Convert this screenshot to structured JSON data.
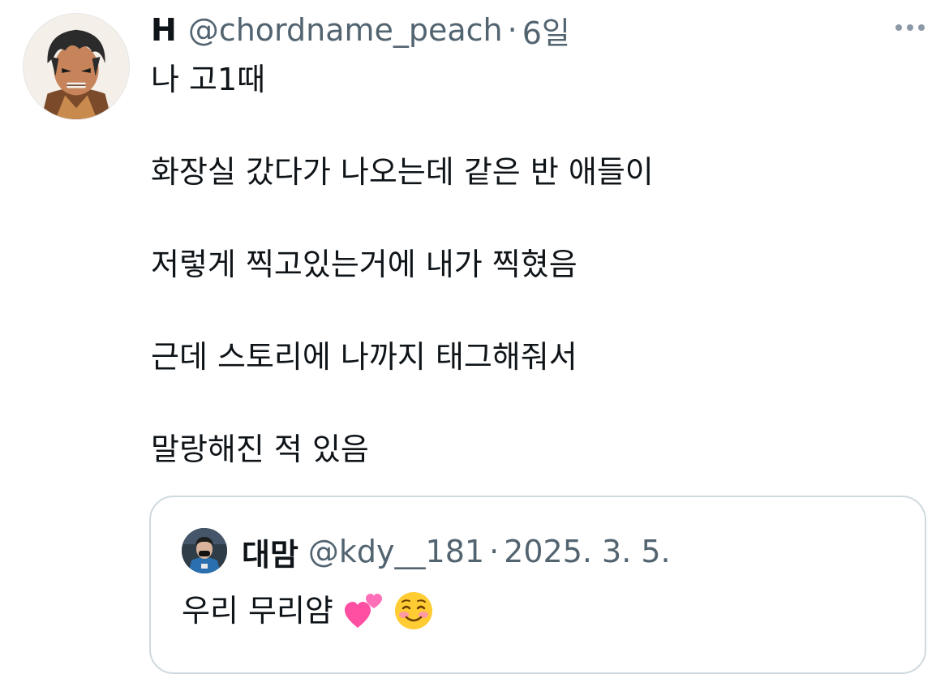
{
  "tweet": {
    "display_name": "H",
    "handle": "@chordname_peach",
    "separator": "·",
    "time": "6일",
    "more_icon": "more-horizontal-icon",
    "lines": [
      "나 고1때",
      "화장실 갔다가 나오는데 같은 반 애들이",
      "저렇게 찍고있는거에 내가 찍혔음",
      "근데 스토리에 나까지 태그해줘서",
      "말랑해진 적 있음"
    ]
  },
  "quote": {
    "display_name": "대맘",
    "handle": "@kdy__181",
    "separator": "·",
    "time": "2025. 3. 5.",
    "text": "우리 무리얌",
    "emojis": [
      "two-hearts-emoji",
      "smiling-face-emoji"
    ]
  },
  "colors": {
    "text_primary": "#0f1419",
    "text_secondary": "#536471",
    "border": "#cfd9de"
  }
}
